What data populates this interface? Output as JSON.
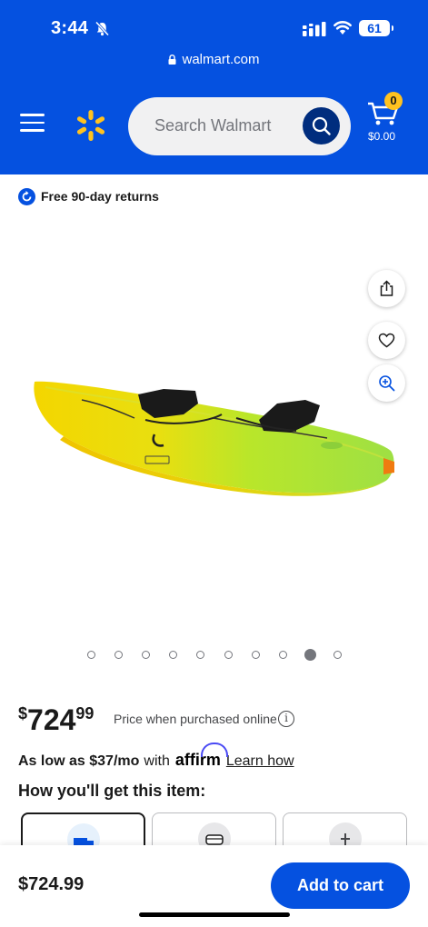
{
  "status_bar": {
    "time": "3:44",
    "battery": "61"
  },
  "browser": {
    "url": "walmart.com"
  },
  "header": {
    "search_placeholder": "Search Walmart",
    "cart_count": "0",
    "cart_total": "$0.00",
    "brand_color": "#0551e0",
    "spark_color": "#ffc220"
  },
  "returns": {
    "label": "Free 90-day returns"
  },
  "gallery": {
    "dot_count": 10,
    "active_index": 8
  },
  "price": {
    "currency": "$",
    "dollars": "724",
    "cents": "99",
    "note": "Price when purchased online",
    "info_glyph": "i"
  },
  "financing": {
    "as_low_as": "As low as $37/mo",
    "with": "with",
    "provider": "affirm",
    "learn_link": "Learn how"
  },
  "fulfillment": {
    "heading": "How you'll get this item:"
  },
  "bottom_bar": {
    "price": "$724.99",
    "add_to_cart": "Add to cart"
  }
}
